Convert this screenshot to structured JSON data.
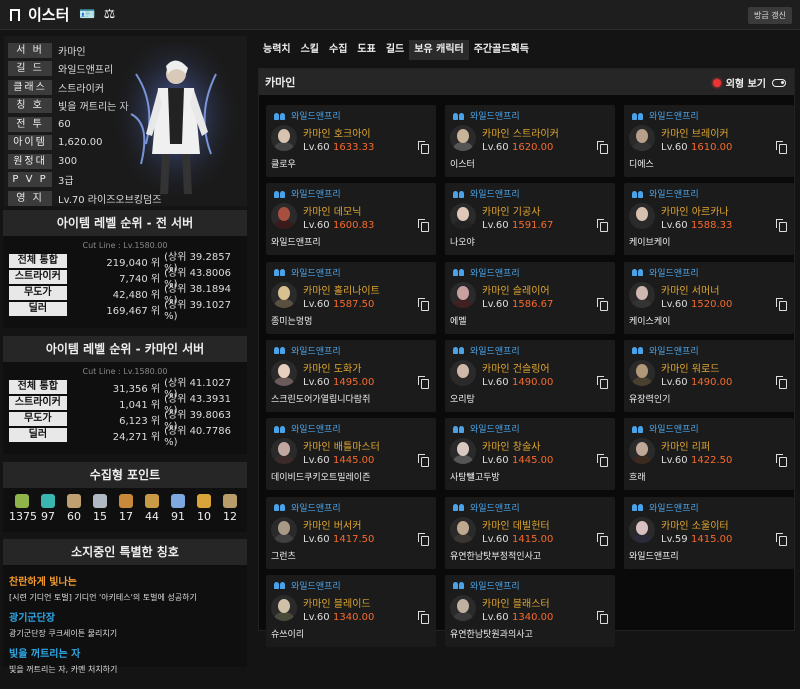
{
  "topbar": {
    "title": "이스터",
    "update_button": "방금 갱신"
  },
  "profile": {
    "rows": [
      {
        "label": "서 버",
        "value": "카마인"
      },
      {
        "label": "길 드",
        "value": "와일드앤프리"
      },
      {
        "label": "클래스",
        "value": "스트라이커"
      },
      {
        "label": "칭 호",
        "value": "빛을 꺼트리는 자"
      },
      {
        "label": "전 투",
        "value": "60"
      },
      {
        "label": "아이템",
        "value": "1,620.00"
      },
      {
        "label": "원정대",
        "value": "300"
      },
      {
        "label": "P V P",
        "value": "3급"
      },
      {
        "label": "영 지",
        "value": "Lv.70 라이즈오브킹덤즈"
      }
    ]
  },
  "rank_all": {
    "title": "아이템 레벨 순위 - 전 서버",
    "cutline": "Cut Line : Lv.1580.00",
    "rows": [
      {
        "label": "전체 통합",
        "value": "219,040 위",
        "pct": "(상위 39.2857 %)"
      },
      {
        "label": "스트라이커",
        "value": "7,740 위",
        "pct": "(상위 43.8006 %)"
      },
      {
        "label": "무도가",
        "value": "42,480 위",
        "pct": "(상위 38.1894 %)"
      },
      {
        "label": "딜러",
        "value": "169,467 위",
        "pct": "(상위 39.1027 %)"
      }
    ]
  },
  "rank_server": {
    "title": "아이템 레벨 순위 - 카마인 서버",
    "cutline": "Cut Line : Lv.1580.00",
    "rows": [
      {
        "label": "전체 통합",
        "value": "31,356 위",
        "pct": "(상위 41.1027 %)"
      },
      {
        "label": "스트라이커",
        "value": "1,041 위",
        "pct": "(상위 43.3931 %)"
      },
      {
        "label": "무도가",
        "value": "6,123 위",
        "pct": "(상위 39.8063 %)"
      },
      {
        "label": "딜러",
        "value": "24,271 위",
        "pct": "(상위 40.7786 %)"
      }
    ]
  },
  "collect": {
    "title": "수집형 포인트",
    "items": [
      {
        "icon": "mokoko-seed-icon",
        "value": "1375",
        "color": "#8fb54a"
      },
      {
        "icon": "island-heart-icon",
        "value": "97",
        "color": "#39b6b0"
      },
      {
        "icon": "art-icon",
        "value": "60",
        "color": "#c0a070"
      },
      {
        "icon": "giant-heart-icon",
        "value": "15",
        "color": "#b0b8c4"
      },
      {
        "icon": "ignea-token-icon",
        "value": "17",
        "color": "#c88a3a"
      },
      {
        "icon": "voyage-icon",
        "value": "44",
        "color": "#c89a45"
      },
      {
        "icon": "star-feather-icon",
        "value": "91",
        "color": "#7da9e0"
      },
      {
        "icon": "orpheus-star-icon",
        "value": "10",
        "color": "#d9a53a"
      },
      {
        "icon": "music-box-icon",
        "value": "12",
        "color": "#b89c6a"
      }
    ]
  },
  "titles_box": {
    "title": "소지중인 특별한 칭호",
    "items": [
      {
        "name": "찬란하게 빛나는",
        "desc": "[시련 기디언 토벌] 기디언 '아키테스'의 토벌에 성공하기",
        "color": "#f29a2e"
      },
      {
        "name": "광기군단장",
        "desc": "광기군단장 쿠크세이튼 물리치기",
        "color": "#2fa7e6"
      },
      {
        "name": "빛을 꺼트리는 자",
        "desc": "빛을 꺼트리는 자, 카멘 처치하기",
        "color": "#2fa7e6"
      }
    ]
  },
  "tabs": [
    "능력치",
    "스킬",
    "수집",
    "도표",
    "길드",
    "보유 캐릭터",
    "주간골드획득"
  ],
  "panel": {
    "server": "카마인",
    "view_toggle": "외형 보기"
  },
  "characters": [
    {
      "guild": "와일드앤프리",
      "server": "카마인",
      "cls": "호크아이",
      "lv": "Lv.60",
      "item": "1633.33",
      "name": "클로우",
      "skin": "#d6c3b0",
      "body": "#444"
    },
    {
      "guild": "와일드앤프리",
      "server": "카마인",
      "cls": "스트라이커",
      "lv": "Lv.60",
      "item": "1620.00",
      "name": "이스터",
      "skin": "#c9b39a",
      "body": "#555"
    },
    {
      "guild": "와일드앤프리",
      "server": "카마인",
      "cls": "브레이커",
      "lv": "Lv.60",
      "item": "1610.00",
      "name": "디에스",
      "skin": "#b8a08a",
      "body": "#333"
    },
    {
      "guild": "와일드앤프리",
      "server": "카마인",
      "cls": "데모닉",
      "lv": "Lv.60",
      "item": "1600.83",
      "name": "와일드앤프리",
      "skin": "#a85040",
      "body": "#3a1a1a"
    },
    {
      "guild": "와일드앤프리",
      "server": "카마인",
      "cls": "기공사",
      "lv": "Lv.60",
      "item": "1591.67",
      "name": "나오야",
      "skin": "#e0c8b8",
      "body": "#222"
    },
    {
      "guild": "와일드앤프리",
      "server": "카마인",
      "cls": "아르카나",
      "lv": "Lv.60",
      "item": "1588.33",
      "name": "케이브케이",
      "skin": "#d8c0b0",
      "body": "#2a2a2a"
    },
    {
      "guild": "와일드앤프리",
      "server": "카마인",
      "cls": "홀리나이트",
      "lv": "Lv.60",
      "item": "1587.50",
      "name": "종미는멍멍",
      "skin": "#d8c090",
      "body": "#5a5040"
    },
    {
      "guild": "와일드앤프리",
      "server": "카마인",
      "cls": "슬레이어",
      "lv": "Lv.60",
      "item": "1586.67",
      "name": "에멜",
      "skin": "#c8a0a0",
      "body": "#402020"
    },
    {
      "guild": "와일드앤프리",
      "server": "카마인",
      "cls": "서머너",
      "lv": "Lv.60",
      "item": "1520.00",
      "name": "케이스케이",
      "skin": "#d0b8b0",
      "body": "#333"
    },
    {
      "guild": "와일드앤프리",
      "server": "카마인",
      "cls": "도화가",
      "lv": "Lv.60",
      "item": "1495.00",
      "name": "스크린도어가열립니다람쥐",
      "skin": "#e8d0c0",
      "body": "#6a5a5a"
    },
    {
      "guild": "와일드앤프리",
      "server": "카마인",
      "cls": "건슬링어",
      "lv": "Lv.60",
      "item": "1490.00",
      "name": "오리탕",
      "skin": "#d0b8a8",
      "body": "#2a2a2a"
    },
    {
      "guild": "와일드앤프리",
      "server": "카마인",
      "cls": "워로드",
      "lv": "Lv.60",
      "item": "1490.00",
      "name": "유장력인기",
      "skin": "#b09878",
      "body": "#4a4030"
    },
    {
      "guild": "와일드앤프리",
      "server": "카마인",
      "cls": "배틀마스터",
      "lv": "Lv.60",
      "item": "1445.00",
      "name": "데이비드쿠키오트밀레이즌",
      "skin": "#c0a8a0",
      "body": "#3a2a2a"
    },
    {
      "guild": "와일드앤프리",
      "server": "카마인",
      "cls": "창술사",
      "lv": "Lv.60",
      "item": "1445.00",
      "name": "사탕뺄고두방",
      "skin": "#d8c8c0",
      "body": "#555"
    },
    {
      "guild": "와일드앤프리",
      "server": "카마인",
      "cls": "리퍼",
      "lv": "Lv.60",
      "item": "1422.50",
      "name": "흐래",
      "skin": "#c0a898",
      "body": "#3a2a20"
    },
    {
      "guild": "와일드앤프리",
      "server": "카마인",
      "cls": "버서커",
      "lv": "Lv.60",
      "item": "1417.50",
      "name": "그런츠",
      "skin": "#a89888",
      "body": "#404040"
    },
    {
      "guild": "와일드앤프리",
      "server": "카마인",
      "cls": "데빌헌터",
      "lv": "Lv.60",
      "item": "1415.00",
      "name": "유연한남탓부정적인사고",
      "skin": "#c0a890",
      "body": "#3a3530"
    },
    {
      "guild": "와일드앤프리",
      "server": "카마인",
      "cls": "소울이터",
      "lv": "Lv.59",
      "item": "1415.00",
      "name": "와일드앤프리",
      "skin": "#d8c0c0",
      "body": "#2a2a3a"
    },
    {
      "guild": "와일드앤프리",
      "server": "카마인",
      "cls": "블레이드",
      "lv": "Lv.60",
      "item": "1340.00",
      "name": "슈쓰이리",
      "skin": "#d0c0a8",
      "body": "#4a4a3a"
    },
    {
      "guild": "와일드앤프리",
      "server": "카마인",
      "cls": "블래스터",
      "lv": "Lv.60",
      "item": "1340.00",
      "name": "유연한남탓원과의사고",
      "skin": "#c0b0a0",
      "body": "#3a3a3a"
    }
  ]
}
